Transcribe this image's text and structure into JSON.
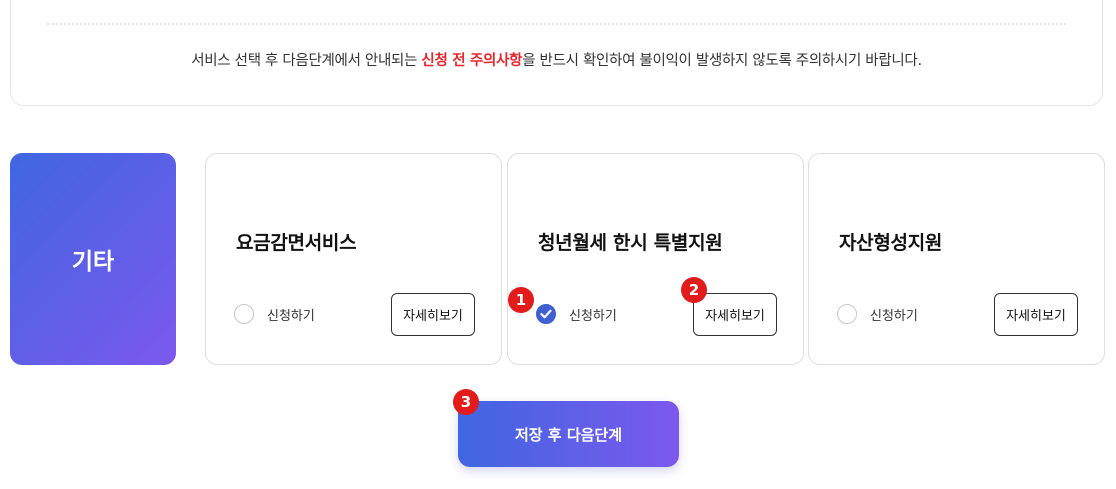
{
  "notice": {
    "text_before": "서비스 선택 후 다음단계에서 안내되는 ",
    "text_emphasis": "신청 전 주의사항",
    "text_after": "을 반드시 확인하여 불이익이 발생하지 않도록 주의하시기 바랍니다.",
    "emphasis_color": "#e8262b"
  },
  "category": {
    "label": "기타"
  },
  "cards": [
    {
      "title": "요금감면서비스",
      "radio_label": "신청하기",
      "checked": false,
      "detail_label": "자세히보기"
    },
    {
      "title": "청년월세 한시 특별지원",
      "radio_label": "신청하기",
      "checked": true,
      "detail_label": "자세히보기"
    },
    {
      "title": "자산형성지원",
      "radio_label": "신청하기",
      "checked": false,
      "detail_label": "자세히보기"
    }
  ],
  "badges": [
    "1",
    "2",
    "3"
  ],
  "next_button": {
    "label": "저장 후 다음단계"
  },
  "colors": {
    "accent_start": "#3f67e1",
    "accent_end": "#7c58ee",
    "badge": "#e21b1b",
    "radio_checked": "#3f5fd3"
  }
}
